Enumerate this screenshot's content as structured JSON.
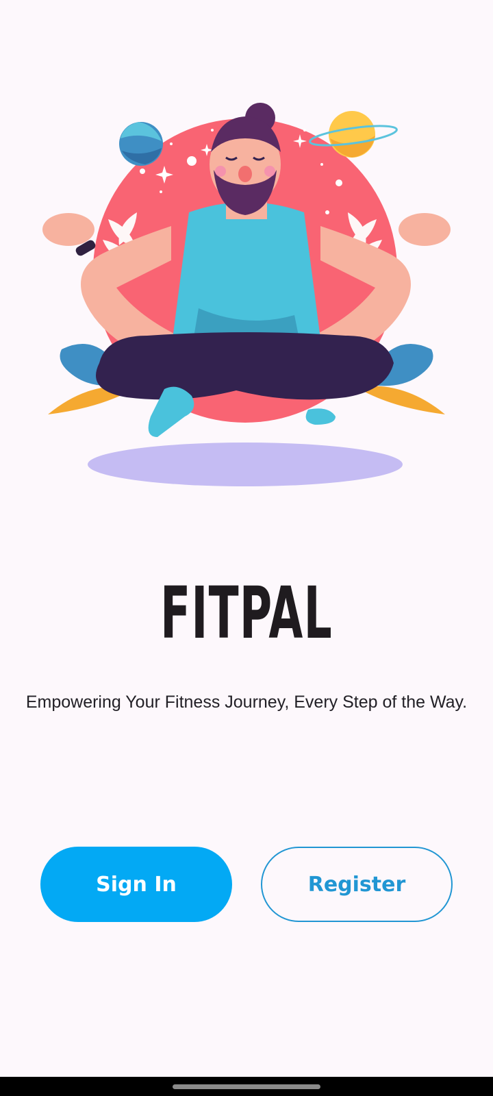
{
  "app": {
    "title": "FITPAL",
    "tagline": "Empowering Your Fitness Journey, Every Step of the Way."
  },
  "illustration": {
    "icon": "meditation-illustration"
  },
  "actions": {
    "sign_in_label": "Sign In",
    "register_label": "Register"
  },
  "colors": {
    "background": "#fdf8fc",
    "primary": "#03a9f4",
    "outline": "#2196d3",
    "title": "#1f1b1f",
    "circle": "#f96473",
    "shadow": "#c5bcf3"
  }
}
